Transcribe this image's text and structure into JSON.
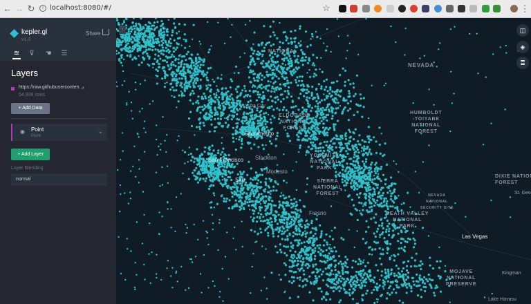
{
  "browser": {
    "url": "localhost:8080/#/"
  },
  "app": {
    "logo": "kepler.gl",
    "version": "v1.0",
    "share_label": "Share",
    "panel_title": "Layers",
    "dataset": {
      "name": "https://raw.githubuserconten...",
      "rows": "54,936 rows",
      "color": "#b135c2"
    },
    "add_data_label": "Add Data",
    "layer": {
      "name": "Point",
      "type": "Point"
    },
    "add_layer_label": "Add Layer",
    "blend_label": "Layer Blending",
    "blend_value": "normal"
  },
  "map": {
    "point_color": "#2cc1c9",
    "region_labels": [
      {
        "text": "NEVADA"
      },
      {
        "text": "ELDORADO\nNATIONAL\nFOREST"
      },
      {
        "text": "HUMBOLDT\n-TOIYABE\nNATIONAL\nFOREST"
      },
      {
        "text": "YOSEMITE\nNATIONAL\nPARK"
      },
      {
        "text": "SIERRA\nNATIONAL\nFOREST"
      },
      {
        "text": "DEATH VALLEY\nNATIONAL\nPARK"
      },
      {
        "text": "NEVADA\nNATIONAL\nSECURITY SITE"
      },
      {
        "text": "DIXIE NATIONAL\nFOREST"
      },
      {
        "text": "MOJAVE\nNATIONAL\nPRESERVE"
      },
      {
        "text": "NATIONAL"
      }
    ],
    "cities": [
      {
        "text": "Sacramento"
      },
      {
        "text": "San Francisco"
      },
      {
        "text": "San"
      },
      {
        "text": "Stockton"
      },
      {
        "text": "Modesto"
      },
      {
        "text": "Yuba City"
      },
      {
        "text": "Fresno"
      },
      {
        "text": "Las Vegas"
      },
      {
        "text": "St. Geo"
      },
      {
        "text": "Kingman"
      },
      {
        "text": "Lake Havasu"
      }
    ]
  }
}
